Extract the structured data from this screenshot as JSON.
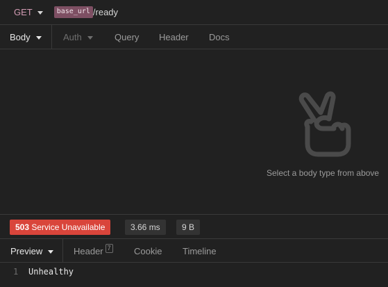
{
  "request": {
    "method": "GET",
    "url_variable": "base_url",
    "url_path": "/ready"
  },
  "request_tabs": {
    "body": "Body",
    "auth": "Auth",
    "query": "Query",
    "header": "Header",
    "docs": "Docs"
  },
  "body_panel": {
    "empty_message": "Select a body type from above",
    "icon": "peace-hand-icon"
  },
  "status": {
    "code": "503",
    "text": "Service Unavailable",
    "time": "3.66 ms",
    "size": "9 B",
    "error_color": "#d9453b"
  },
  "response_tabs": {
    "preview": "Preview",
    "header": "Header",
    "header_count": "7",
    "cookie": "Cookie",
    "timeline": "Timeline"
  },
  "response": {
    "line_number": "1",
    "content": "Unhealthy"
  }
}
